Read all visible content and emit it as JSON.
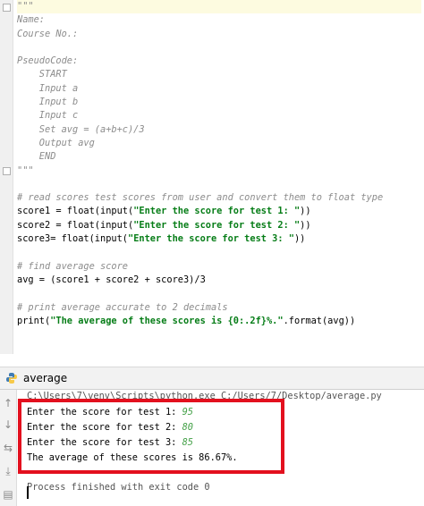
{
  "editor": {
    "lines": [
      {
        "cls": "doc",
        "text": "\"\"\""
      },
      {
        "cls": "doc",
        "text": "Name:"
      },
      {
        "cls": "doc",
        "text": "Course No.:"
      },
      {
        "cls": "doc",
        "text": ""
      },
      {
        "cls": "doc",
        "text": "PseudoCode:"
      },
      {
        "cls": "doc",
        "text": "    START"
      },
      {
        "cls": "doc",
        "text": "    Input a"
      },
      {
        "cls": "doc",
        "text": "    Input b"
      },
      {
        "cls": "doc",
        "text": "    Input c"
      },
      {
        "cls": "doc",
        "text": "    Set avg = (a+b+c)/3"
      },
      {
        "cls": "doc",
        "text": "    Output avg"
      },
      {
        "cls": "doc",
        "text": "    END"
      },
      {
        "cls": "doc",
        "text": "\"\"\""
      },
      {
        "cls": "plain",
        "text": ""
      },
      {
        "cls": "cmt",
        "text": "# read scores test scores from user and convert them to float type"
      },
      {
        "cls": "code",
        "parts": [
          {
            "t": "score1 = float(input(",
            "c": "plain"
          },
          {
            "t": "\"Enter the score for test 1: \"",
            "c": "str"
          },
          {
            "t": "))",
            "c": "plain"
          }
        ]
      },
      {
        "cls": "code",
        "parts": [
          {
            "t": "score2 = float(input(",
            "c": "plain"
          },
          {
            "t": "\"Enter the score for test 2: \"",
            "c": "str"
          },
          {
            "t": "))",
            "c": "plain"
          }
        ]
      },
      {
        "cls": "code",
        "parts": [
          {
            "t": "score3= float(input(",
            "c": "plain"
          },
          {
            "t": "\"Enter the score for test 3: \"",
            "c": "str"
          },
          {
            "t": "))",
            "c": "plain"
          }
        ]
      },
      {
        "cls": "plain",
        "text": ""
      },
      {
        "cls": "cmt",
        "text": "# find average score"
      },
      {
        "cls": "plain",
        "text": "avg = (score1 + score2 + score3)/3"
      },
      {
        "cls": "plain",
        "text": ""
      },
      {
        "cls": "cmt",
        "text": "# print average accurate to 2 decimals"
      },
      {
        "cls": "code",
        "parts": [
          {
            "t": "print(",
            "c": "plain"
          },
          {
            "t": "\"The average of these scores is {0:.2f}%.\"",
            "c": "str"
          },
          {
            "t": ".format(avg))",
            "c": "plain"
          }
        ]
      }
    ]
  },
  "run_panel": {
    "title": "average",
    "icon": "python-icon",
    "toolbar_icons": [
      "arrow-up-icon",
      "arrow-down-icon",
      "soft-wrap-icon",
      "scroll-to-end-icon",
      "print-icon"
    ]
  },
  "console": {
    "command": "C:\\Users\\7\\venv\\Scripts\\python.exe C:/Users/7/Desktop/average.py",
    "prompts": [
      {
        "prompt": "Enter the score for test 1: ",
        "input": "95"
      },
      {
        "prompt": "Enter the score for test 2: ",
        "input": "80"
      },
      {
        "prompt": "Enter the score for test 3: ",
        "input": "85"
      }
    ],
    "result": "The average of these scores is 86.67%.",
    "exit_message": "Process finished with exit code 0"
  },
  "colors": {
    "highlight_box": "#e3101e",
    "string": "#067d17",
    "comment": "#8c8c8c",
    "user_input": "#43a047"
  }
}
